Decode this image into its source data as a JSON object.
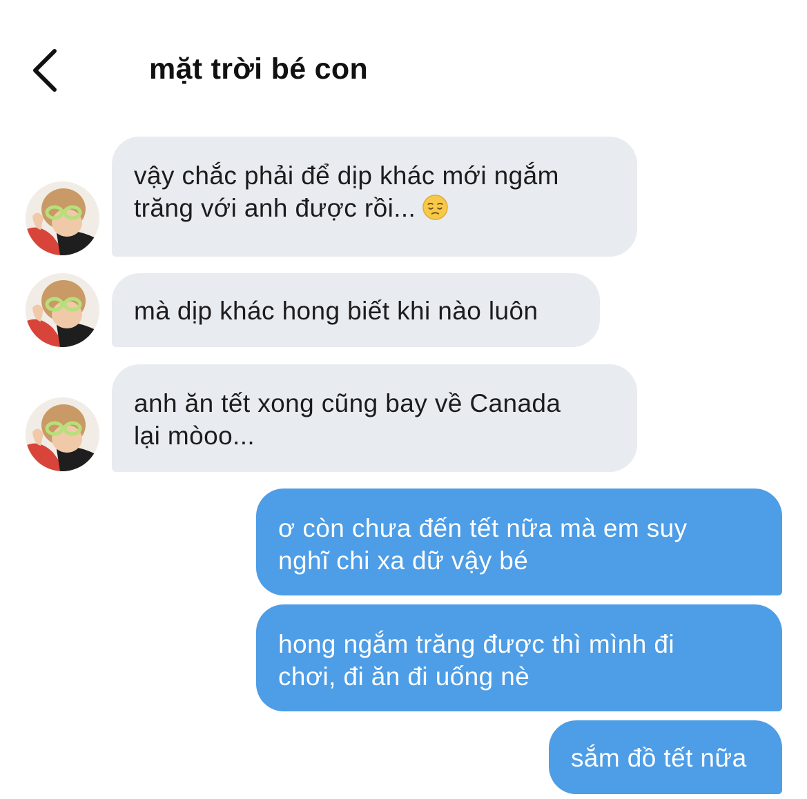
{
  "header": {
    "title": "mặt trời bé con",
    "back_icon": "chevron-left-icon"
  },
  "messages": [
    {
      "sender": "them",
      "lines": [
        "vậy chắc phải để dịp khác mới ngắm",
        "trăng với anh được rồi..."
      ],
      "emoji": "pensive-face-emoji"
    },
    {
      "sender": "them",
      "lines": [
        "mà dịp khác hong biết khi nào luôn"
      ]
    },
    {
      "sender": "them",
      "lines": [
        "anh ăn tết xong cũng bay về Canada",
        "lại mòoo..."
      ]
    },
    {
      "sender": "me",
      "lines": [
        "ơ còn chưa đến tết nữa mà em suy",
        "nghĩ chi xa dữ vậy bé"
      ]
    },
    {
      "sender": "me",
      "lines": [
        "hong ngắm trăng được thì mình đi",
        "chơi, đi ăn đi uống nè"
      ]
    },
    {
      "sender": "me",
      "lines": [
        "sắm đồ tết nữa"
      ]
    }
  ],
  "colors": {
    "incoming_bubble": "#e8ebef",
    "outgoing_bubble": "#4d9de7",
    "outgoing_text": "#ffffff",
    "incoming_text": "#1c1c1e"
  }
}
